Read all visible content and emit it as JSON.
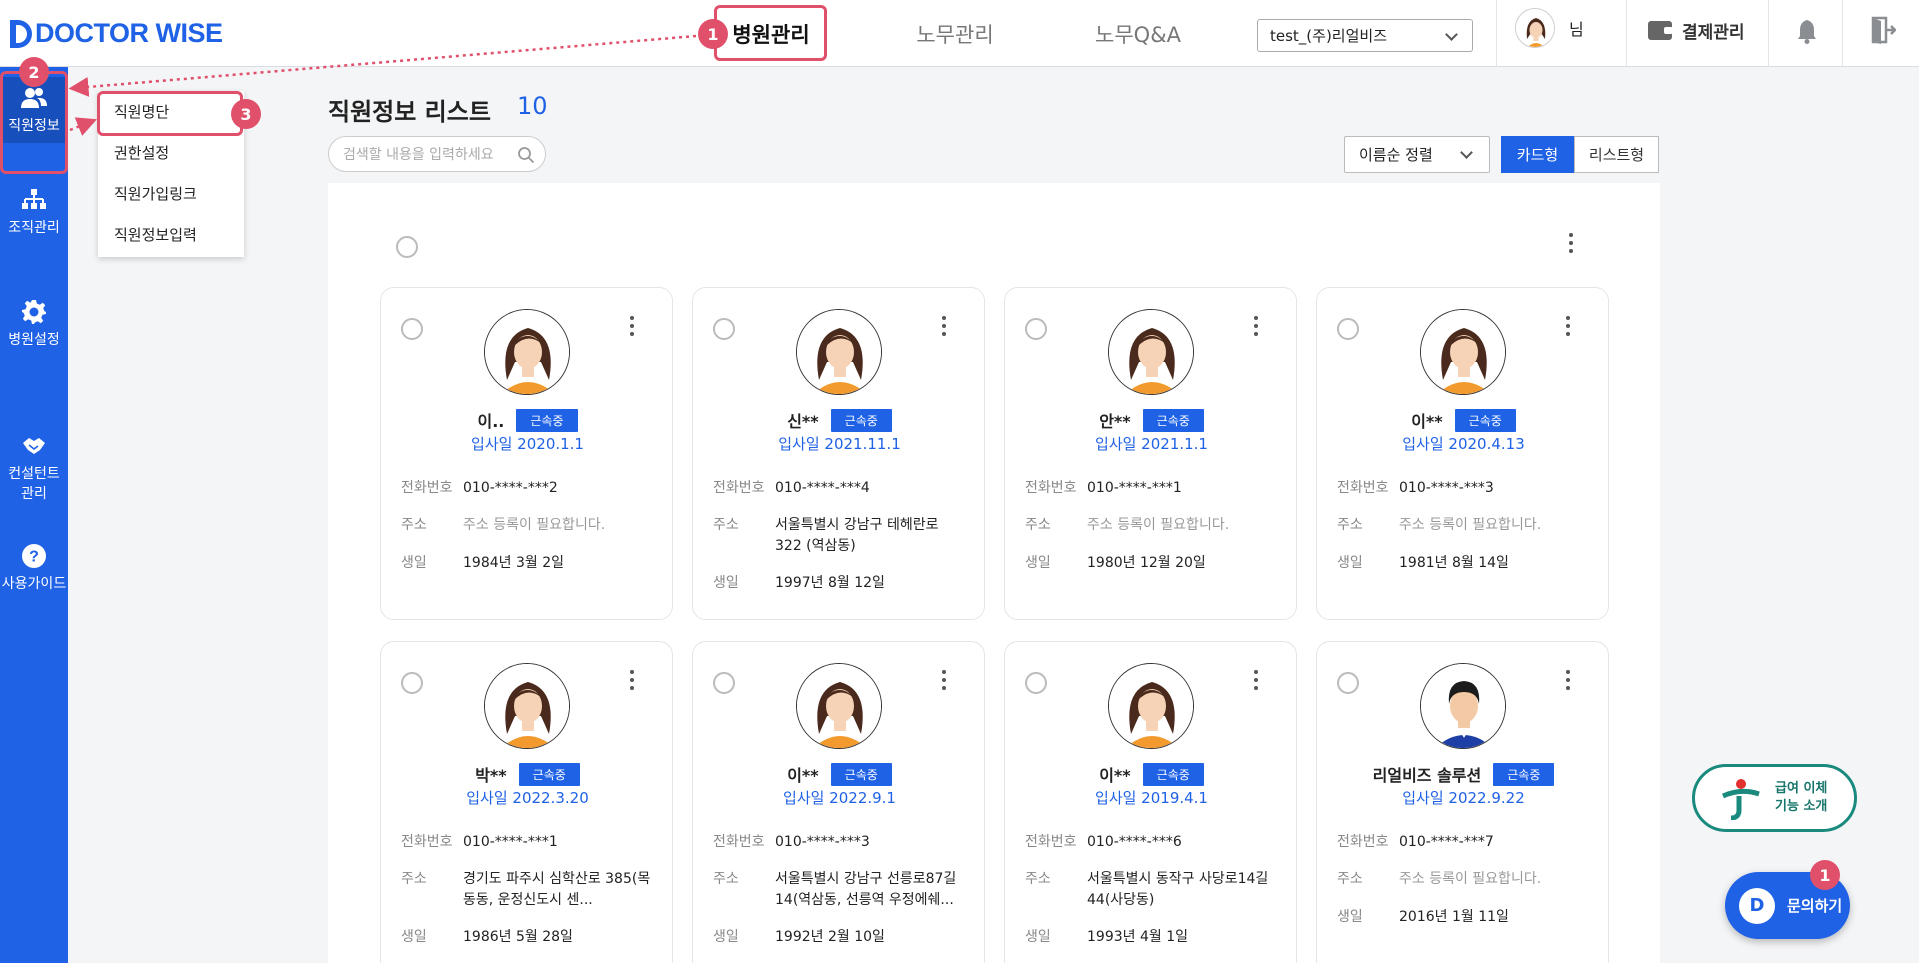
{
  "header": {
    "logo_text": "DOCTOR WISE",
    "nav": [
      "병원관리",
      "노무관리",
      "노무Q&A"
    ],
    "hospital_select": "test_(주)리얼비즈",
    "user_suffix": "님",
    "payment_label": "결제관리"
  },
  "steps": [
    "1",
    "2",
    "3"
  ],
  "sidebar": [
    {
      "label": "직원정보",
      "icon": "users-icon"
    },
    {
      "label": "조직관리",
      "icon": "org-chart-icon"
    },
    {
      "label": "병원설정",
      "icon": "gear-icon"
    },
    {
      "label": "컨설턴트\n관리",
      "icon": "handshake-icon"
    },
    {
      "label": "사용가이드",
      "icon": "help-icon"
    }
  ],
  "submenu": [
    "직원명단",
    "권한설정",
    "직원가입링크",
    "직원정보입력"
  ],
  "main": {
    "title": "직원정보 리스트",
    "count": "10",
    "search_placeholder": "검색할 내용을 입력하세요",
    "sort_label": "이름순 정렬",
    "view_card": "카드형",
    "view_list": "리스트형"
  },
  "labels": {
    "phone": "전화번호",
    "address": "주소",
    "birthday": "생일"
  },
  "employees": [
    {
      "name": "이..",
      "status": "근속중",
      "join": "입사일 2020.1.1",
      "phone": "010-****-***2",
      "address": "주소 등록이 필요합니다.",
      "birthday": "1984년 3월 2일",
      "avatar": "female"
    },
    {
      "name": "신**",
      "status": "근속중",
      "join": "입사일 2021.11.1",
      "phone": "010-****-***4",
      "address": "서울특별시 강남구 테헤란로 322 (역삼동)",
      "birthday": "1997년 8월 12일",
      "avatar": "female"
    },
    {
      "name": "안**",
      "status": "근속중",
      "join": "입사일 2021.1.1",
      "phone": "010-****-***1",
      "address": "주소 등록이 필요합니다.",
      "birthday": "1980년 12월 20일",
      "avatar": "female"
    },
    {
      "name": "이**",
      "status": "근속중",
      "join": "입사일 2020.4.13",
      "phone": "010-****-***3",
      "address": "주소 등록이 필요합니다.",
      "birthday": "1981년 8월 14일",
      "avatar": "female"
    },
    {
      "name": "박**",
      "status": "근속중",
      "join": "입사일 2022.3.20",
      "phone": "010-****-***1",
      "address": "경기도 파주시 심학산로 385(목동동, 운정신도시 센...",
      "birthday": "1986년 5월 28일",
      "avatar": "female"
    },
    {
      "name": "이**",
      "status": "근속중",
      "join": "입사일 2022.9.1",
      "phone": "010-****-***3",
      "address": "서울특별시 강남구 선릉로87길 14(역삼동, 선릉역 우정에쉐...",
      "birthday": "1992년 2월 10일",
      "avatar": "female"
    },
    {
      "name": "이**",
      "status": "근속중",
      "join": "입사일 2019.4.1",
      "phone": "010-****-***6",
      "address": "서울특별시 동작구 사당로14길 44(사당동)",
      "birthday": "1993년 4월 1일",
      "avatar": "female"
    },
    {
      "name": "리얼비즈 솔루션",
      "status": "근속중",
      "join": "입사일 2022.9.22",
      "phone": "010-****-***7",
      "address": "주소 등록이 필요합니다.",
      "birthday": "2016년 1월 11일",
      "avatar": "male"
    }
  ],
  "float": {
    "transfer_line1": "급여 이체",
    "transfer_line2": "기능 소개",
    "inquire_label": "문의하기",
    "inquire_icon": "D",
    "inquire_badge": "1"
  },
  "colors": {
    "brand": "#1f62e6",
    "highlight": "#e0506b",
    "teal": "#1a8a7e"
  }
}
